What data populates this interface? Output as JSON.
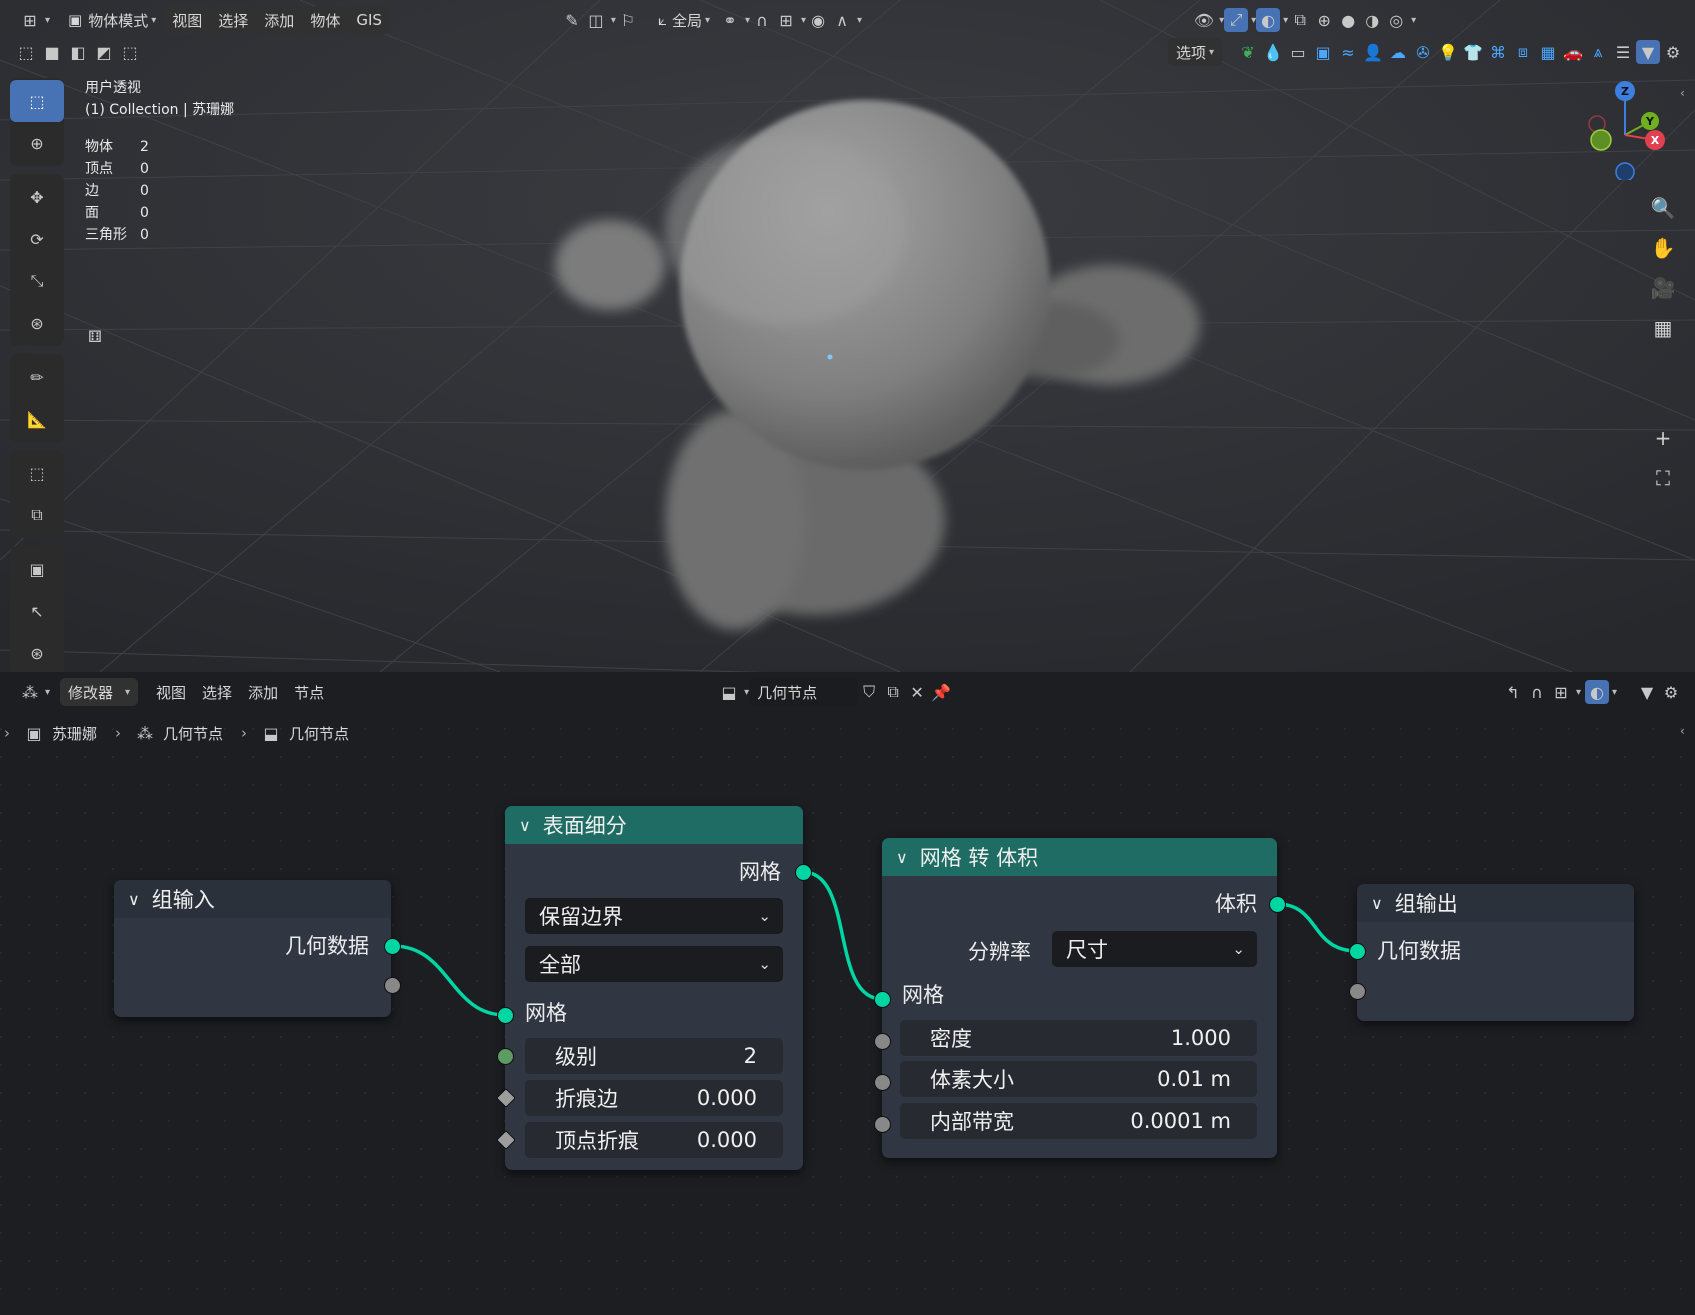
{
  "viewport": {
    "header": {
      "mode": "物体模式",
      "menus": [
        "视图",
        "选择",
        "添加",
        "物体",
        "GIS"
      ],
      "transform_orientation": "全局",
      "options": "选项"
    },
    "view_name": "用户透视",
    "collection_label": "(1) Collection | 苏珊娜",
    "stats": [
      {
        "label": "物体",
        "value": "2"
      },
      {
        "label": "顶点",
        "value": "0"
      },
      {
        "label": "边",
        "value": "0"
      },
      {
        "label": "面",
        "value": "0"
      },
      {
        "label": "三角形",
        "value": "0"
      }
    ],
    "gizmo": {
      "z": "Z",
      "y": "Y",
      "x": "X"
    }
  },
  "node_editor": {
    "header": {
      "context": "修改器",
      "menus": [
        "视图",
        "选择",
        "添加",
        "节点"
      ],
      "node_tree": "几何节点"
    },
    "breadcrumbs": [
      "苏珊娜",
      "几何节点",
      "几何节点"
    ],
    "nodes": {
      "group_input": {
        "title": "组输入",
        "output": "几何数据"
      },
      "subdivide": {
        "title": "表面细分",
        "output": "网格",
        "uv_smooth": "保留边界",
        "boundary": "全部",
        "input": "网格",
        "level_label": "级别",
        "level_value": "2",
        "crease_label": "折痕边",
        "crease_value": "0.000",
        "vcrease_label": "顶点折痕",
        "vcrease_value": "0.000"
      },
      "mesh_to_volume": {
        "title": "网格 转 体积",
        "output": "体积",
        "resolution_label": "分辨率",
        "resolution_value": "尺寸",
        "input": "网格",
        "density_label": "密度",
        "density_value": "1.000",
        "voxel_label": "体素大小",
        "voxel_value": "0.01 m",
        "interior_label": "内部带宽",
        "interior_value": "0.0001 m"
      },
      "group_output": {
        "title": "组输出",
        "input": "几何数据"
      }
    }
  },
  "colors": {
    "teal_socket": "#00d6a3",
    "node_header_teal": "#1e6c63",
    "node_body": "#303642",
    "active_tool": "#4772b3"
  }
}
